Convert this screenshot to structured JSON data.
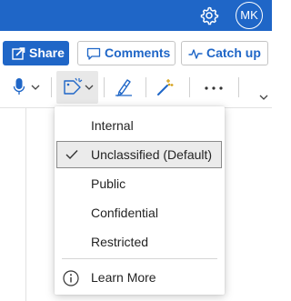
{
  "titlebar": {
    "settings_icon": "gear-icon",
    "avatar_initials": "MK",
    "background": "#1f66c7"
  },
  "ribbon": {
    "share_label": "Share",
    "comments_label": "Comments",
    "catchup_label": "Catch up",
    "tools": [
      {
        "name": "dictate",
        "icon": "microphone-icon",
        "has_dropdown": true
      },
      {
        "name": "sensitivity",
        "icon": "sensitivity-label-icon",
        "has_dropdown": true,
        "active": true
      },
      {
        "name": "editor",
        "icon": "editor-pen-icon"
      },
      {
        "name": "designer",
        "icon": "magic-wand-icon"
      },
      {
        "name": "more-options",
        "icon": "more-icon"
      },
      {
        "name": "expand-ribbon",
        "icon": "chevron-down-icon"
      }
    ]
  },
  "sensitivity_menu": {
    "items": [
      {
        "label": "Internal",
        "selected": false
      },
      {
        "label": "Unclassified (Default)",
        "selected": true
      },
      {
        "label": "Public",
        "selected": false
      },
      {
        "label": "Confidential",
        "selected": false
      },
      {
        "label": "Restricted",
        "selected": false
      }
    ],
    "learn_more_label": "Learn More"
  }
}
